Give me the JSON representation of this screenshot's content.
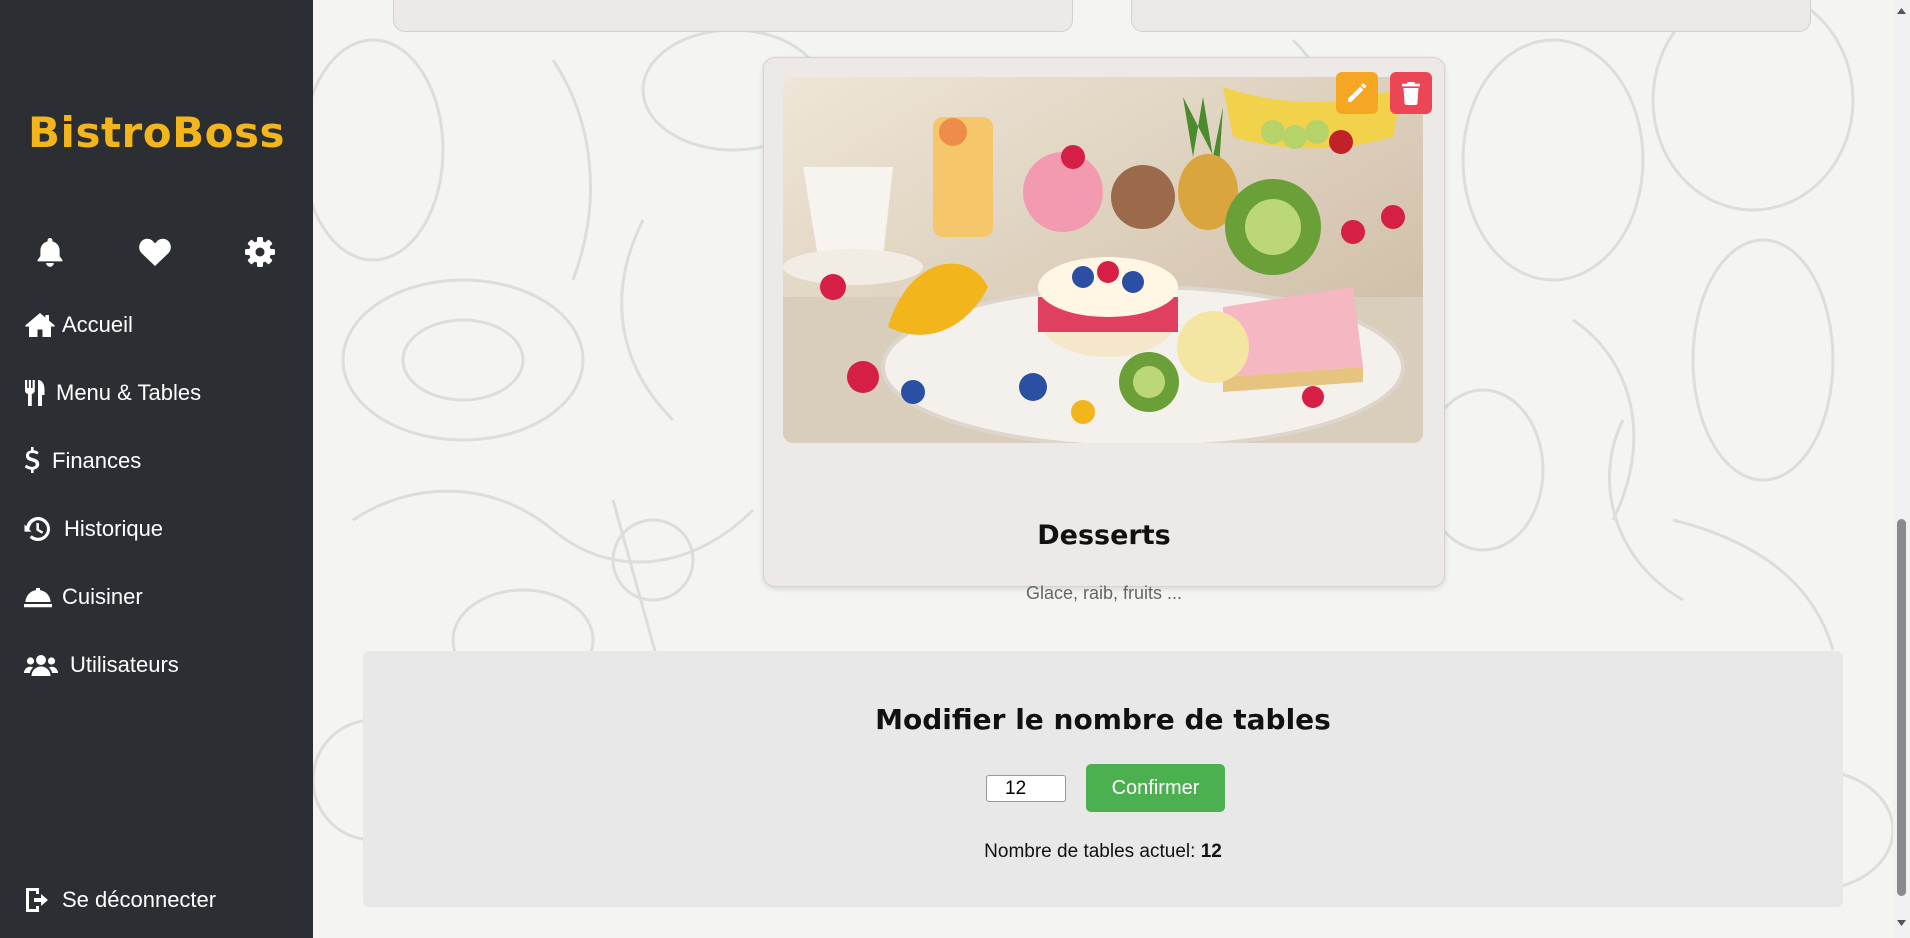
{
  "sidebar": {
    "brand": "BistroBoss",
    "quick_icons": [
      "bell-icon",
      "heart-icon",
      "gear-icon"
    ],
    "items": [
      {
        "label": "Accueil",
        "icon": "home-icon"
      },
      {
        "label": "Menu & Tables",
        "icon": "utensils-icon"
      },
      {
        "label": "Finances",
        "icon": "dollar-icon"
      },
      {
        "label": "Historique",
        "icon": "history-icon"
      },
      {
        "label": "Cuisiner",
        "icon": "cloche-icon"
      },
      {
        "label": "Utilisateurs",
        "icon": "users-icon"
      }
    ],
    "logout": "Se déconnecter"
  },
  "category_card": {
    "title": "Desserts",
    "description": "Glace, raib, fruits ...",
    "image_alt": "Desserts"
  },
  "tables_panel": {
    "title": "Modifier le nombre de tables",
    "input_value": "12",
    "confirm_label": "Confirmer",
    "current_label": "Nombre de tables actuel:",
    "current_value": "12"
  },
  "colors": {
    "sidebar_bg": "#2b2f33",
    "brand": "#f2b51c",
    "edit": "#f5a623",
    "delete": "#ec4654",
    "confirm": "#4caf50"
  }
}
